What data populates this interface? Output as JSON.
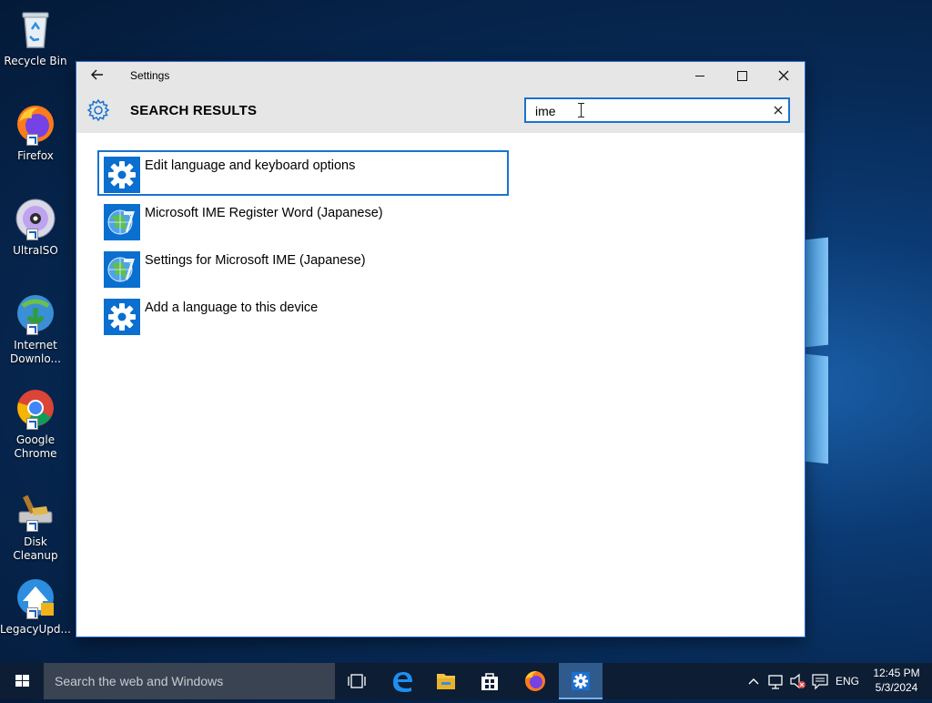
{
  "desktop": {
    "icons": [
      {
        "label": "Recycle Bin"
      },
      {
        "label": "Firefox"
      },
      {
        "label": "UltraISO"
      },
      {
        "label": "Internet Downlo..."
      },
      {
        "label": "Google Chrome"
      },
      {
        "label": "Disk Cleanup"
      },
      {
        "label": "LegacyUpd..."
      }
    ]
  },
  "window": {
    "title": "Settings",
    "header_title": "SEARCH RESULTS",
    "search": {
      "value": "ime"
    },
    "results": [
      {
        "label": "Edit language and keyboard options",
        "icon": "gear-icon",
        "selected": true
      },
      {
        "label": "Microsoft IME Register Word (Japanese)",
        "icon": "ime-globe-icon"
      },
      {
        "label": "Settings for Microsoft IME (Japanese)",
        "icon": "ime-globe-icon"
      },
      {
        "label": "Add a language to this device",
        "icon": "gear-icon"
      }
    ]
  },
  "taskbar": {
    "search_placeholder": "Search the web and Windows",
    "language": "ENG",
    "time": "12:45 PM",
    "date": "5/3/2024"
  },
  "colors": {
    "accent": "#1a73d0",
    "icon_tile": "#0a6fcf",
    "taskbar": "#0d1d33"
  }
}
